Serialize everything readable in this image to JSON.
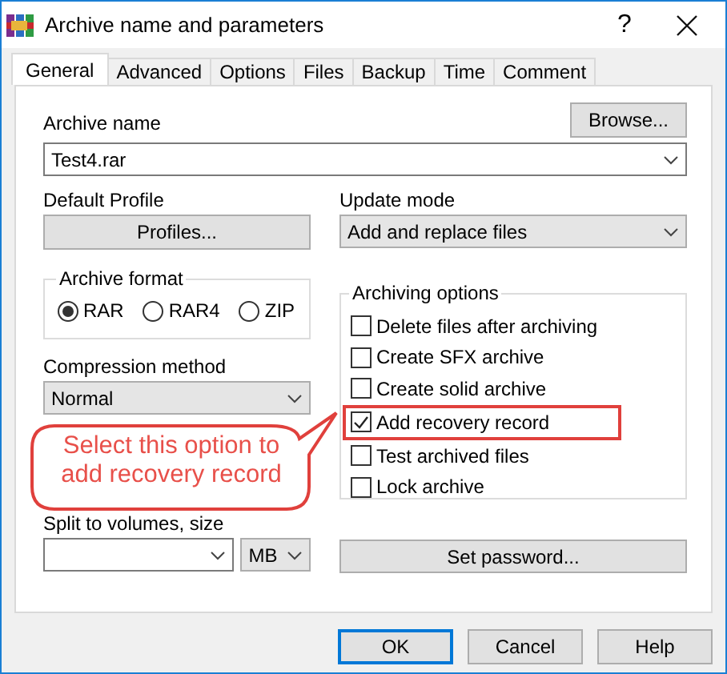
{
  "window": {
    "title": "Archive name and parameters",
    "help_button": "?"
  },
  "tabs": [
    {
      "label": "General",
      "selected": true
    },
    {
      "label": "Advanced",
      "selected": false
    },
    {
      "label": "Options",
      "selected": false
    },
    {
      "label": "Files",
      "selected": false
    },
    {
      "label": "Backup",
      "selected": false
    },
    {
      "label": "Time",
      "selected": false
    },
    {
      "label": "Comment",
      "selected": false
    }
  ],
  "archive_name": {
    "label": "Archive name",
    "value": "Test4.rar",
    "browse_button": "Browse..."
  },
  "default_profile": {
    "label": "Default Profile",
    "button": "Profiles..."
  },
  "update_mode": {
    "label": "Update mode",
    "value": "Add and replace files"
  },
  "archive_format": {
    "title": "Archive format",
    "options": [
      {
        "label": "RAR",
        "selected": true
      },
      {
        "label": "RAR4",
        "selected": false
      },
      {
        "label": "ZIP",
        "selected": false
      }
    ]
  },
  "compression_method": {
    "label": "Compression method",
    "value": "Normal"
  },
  "archiving_options": {
    "title": "Archiving options",
    "options": [
      {
        "label": "Delete files after archiving",
        "checked": false,
        "highlighted": false
      },
      {
        "label": "Create SFX archive",
        "checked": false,
        "highlighted": false
      },
      {
        "label": "Create solid archive",
        "checked": false,
        "highlighted": false
      },
      {
        "label": "Add recovery record",
        "checked": true,
        "highlighted": true
      },
      {
        "label": "Test archived files",
        "checked": false,
        "highlighted": false
      },
      {
        "label": "Lock archive",
        "checked": false,
        "highlighted": false
      }
    ]
  },
  "split_volumes": {
    "label": "Split to volumes, size",
    "unit": "MB"
  },
  "set_password_button": "Set password...",
  "callout": {
    "text": "Select this option to add recovery record"
  },
  "buttons": [
    {
      "label": "OK",
      "default": true
    },
    {
      "label": "Cancel",
      "default": false
    },
    {
      "label": "Help",
      "default": false
    }
  ]
}
